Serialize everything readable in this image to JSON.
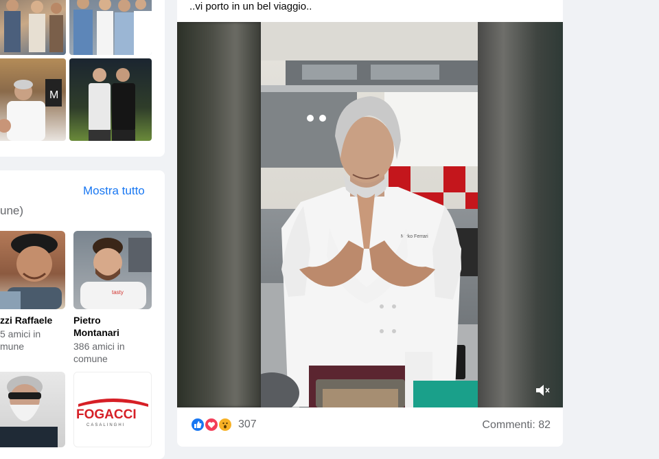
{
  "post": {
    "text": "..vi porto in un bel viaggio..",
    "reactions_count": "307",
    "comments": "Commenti: 82",
    "chef_tag": "Mirko Ferrari"
  },
  "friends": {
    "see_all": "Mostra tutto",
    "subtitle_fragment": "une)",
    "items": [
      {
        "name": "zzi Raffaele",
        "mutual_1": "5 amici in",
        "mutual_2": "mune"
      },
      {
        "name_1": "Pietro",
        "name_2": "Montanari",
        "mutual_1": "386 amici in",
        "mutual_2": "comune"
      }
    ],
    "logo_text": "FOGACCI",
    "logo_sub": "CASALINGHI",
    "shirt_text": "tasty"
  },
  "colors": {
    "link": "#1877f2",
    "like": "#1877f2",
    "love": "#f33e58",
    "wow": "#f7b125",
    "secondary_text": "#65676b"
  },
  "icons": [
    "like-icon",
    "love-icon",
    "wow-icon",
    "mute-icon"
  ]
}
